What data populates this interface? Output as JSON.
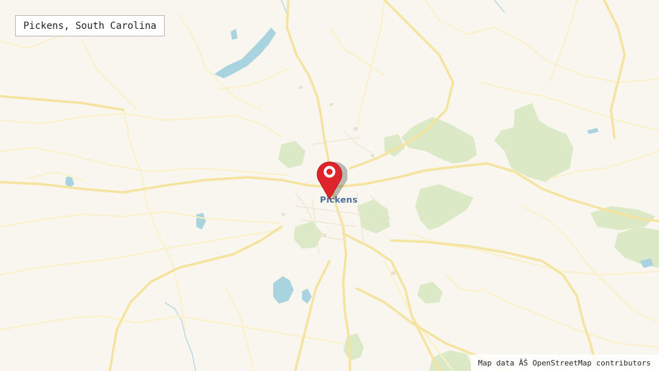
{
  "map": {
    "title": "Pickens, South Carolina",
    "place_label": "Pickens",
    "attribution": "Map data ÂŠ OpenStreetMap contributors",
    "marker_icon": "map-pin-icon",
    "colors": {
      "background": "#f8f6ee",
      "road_major": "#f6e7a6",
      "road_minor": "#fdf5d6",
      "water": "#a9d3df",
      "park": "#d8e8c2",
      "marker": "#e0242c",
      "place_label": "#4d6e95"
    }
  }
}
